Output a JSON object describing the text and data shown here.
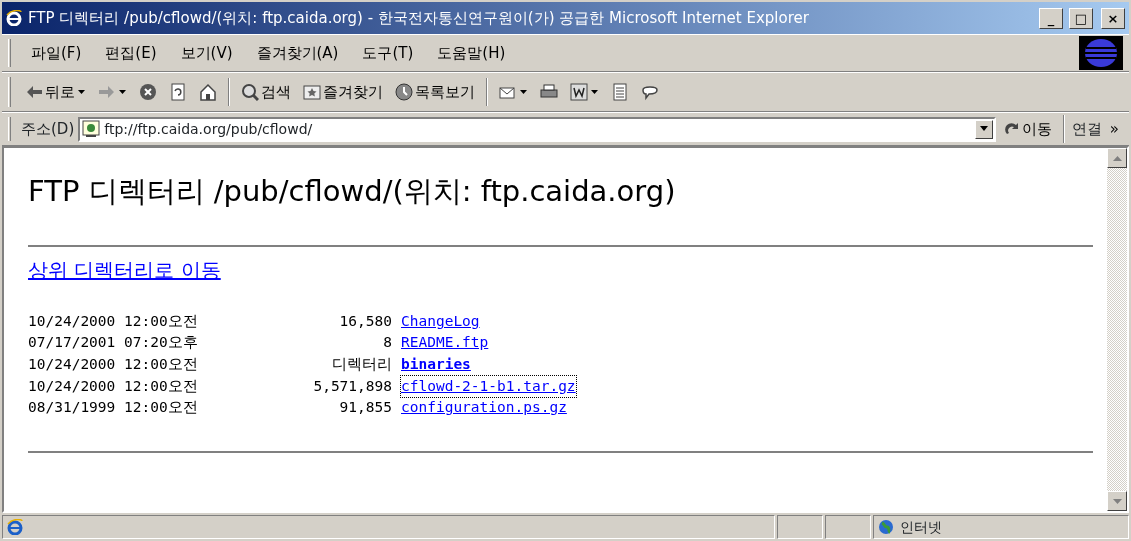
{
  "window": {
    "title": "FTP 디렉터리 /pub/cflowd/(위치: ftp.caida.org) - 한국전자통신연구원이(가) 공급한 Microsoft Internet Explorer",
    "controls": [
      "_",
      "□",
      "×"
    ]
  },
  "menu": [
    "파일(F)",
    "편집(E)",
    "보기(V)",
    "즐겨찾기(A)",
    "도구(T)",
    "도움말(H)"
  ],
  "toolbar": [
    {
      "kind": "back",
      "label": "뒤로",
      "dropdown": true
    },
    {
      "kind": "forward",
      "dropdown": true
    },
    {
      "kind": "stop"
    },
    {
      "kind": "refresh"
    },
    {
      "kind": "home"
    },
    {
      "kind": "search",
      "label": "검색"
    },
    {
      "kind": "favorites",
      "label": "즐겨찾기"
    },
    {
      "kind": "history",
      "label": "목록보기"
    },
    {
      "kind": "mail",
      "dropdown": true
    },
    {
      "kind": "print"
    },
    {
      "kind": "edit",
      "dropdown": true
    },
    {
      "kind": "discuss"
    },
    {
      "kind": "messenger"
    }
  ],
  "address": {
    "label": "주소(D)",
    "value": "ftp://ftp.caida.org/pub/cflowd/",
    "go": "이동",
    "links": "연결",
    "more": "»"
  },
  "content": {
    "heading": "FTP 디렉터리 /pub/cflowd/(위치: ftp.caida.org)",
    "parent_link": "상위 디렉터리로 이동",
    "listing": [
      {
        "date": "10/24/2000 12:00오전",
        "size": "16,580",
        "name": "ChangeLog",
        "kind": "file",
        "focused": false
      },
      {
        "date": "07/17/2001 07:20오후",
        "size": "8",
        "name": "README.ftp",
        "kind": "file",
        "focused": false
      },
      {
        "date": "10/24/2000 12:00오전",
        "size": "디렉터리",
        "name": "binaries",
        "kind": "directory",
        "focused": false
      },
      {
        "date": "10/24/2000 12:00오전",
        "size": "5,571,898",
        "name": "cflowd-2-1-b1.tar.gz",
        "kind": "file",
        "focused": true
      },
      {
        "date": "08/31/1999 12:00오전",
        "size": "91,855",
        "name": "configuration.ps.gz",
        "kind": "file",
        "focused": false
      }
    ]
  },
  "status_bar": {
    "zone": "인터넷"
  }
}
